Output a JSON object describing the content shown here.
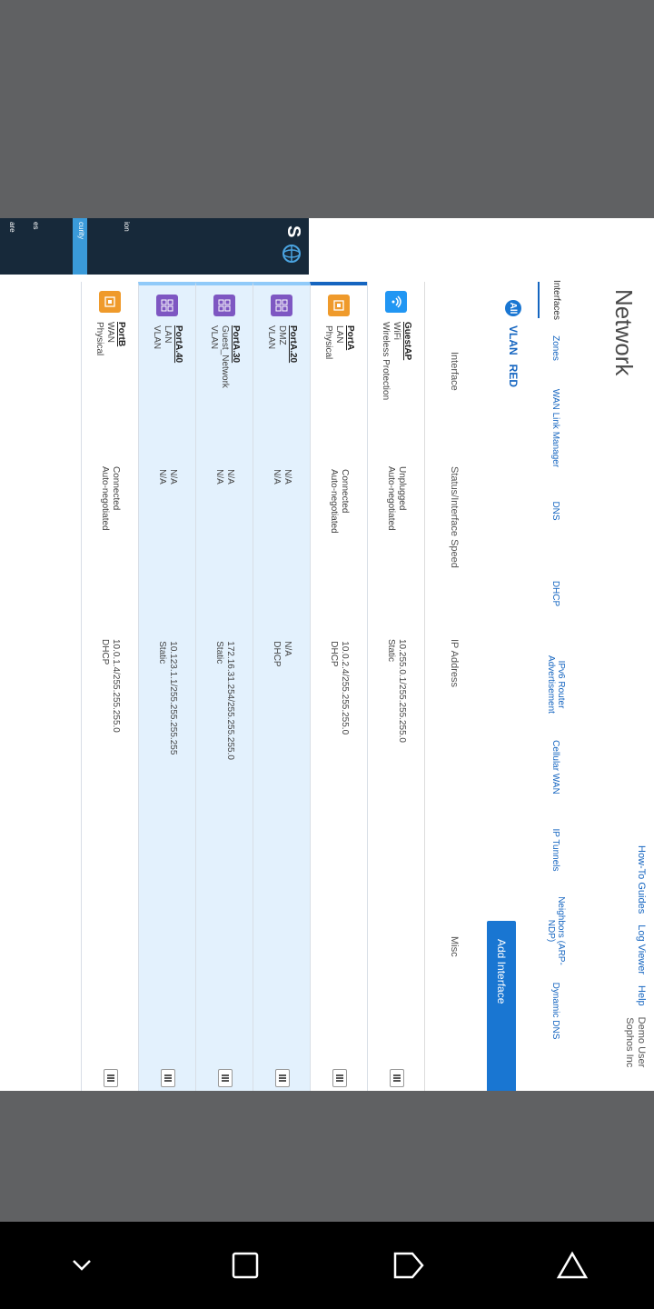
{
  "app": {
    "title": "Network",
    "logo_letter": "S",
    "top_links": [
      "How-To Guides",
      "Log Viewer",
      "Help"
    ],
    "user_name": "Demo User",
    "user_org": "Sophos Inc"
  },
  "tabs": [
    "Interfaces",
    "Zones",
    "WAN Link Manager",
    "DNS",
    "DHCP",
    "IPv6 Router Advertisement",
    "Cellular WAN",
    "IP Tunnels",
    "Neighbors (ARP-NDP)",
    "Dynamic DNS"
  ],
  "filters": {
    "all": "All",
    "vlan": "VLAN",
    "red": "RED"
  },
  "add_button": "Add Interface",
  "columns": {
    "interface": "Interface",
    "status": "Status/Interface Speed",
    "ip": "IP Address",
    "misc": "Misc"
  },
  "rows": [
    {
      "name": "GuestAP",
      "type": "WiFi",
      "sub": "Wireless Protection",
      "icon": "wifi-icon",
      "badge": "wifi",
      "status": "Unplugged",
      "speed": "Auto-negotiated",
      "ip": "10.255.0.1/255.255.255.0",
      "mode": "Static"
    },
    {
      "name": "PortA",
      "type": "LAN",
      "sub": "Physical",
      "icon": "ethernet-icon",
      "badge": "eth",
      "status": "Connected",
      "speed": "Auto-negotiated",
      "ip": "10.0.2.4/255.255.255.0",
      "mode": "DHCP"
    },
    {
      "name": "PortA.20",
      "type": "DMZ",
      "sub": "VLAN",
      "icon": "vlan-icon",
      "badge": "vlan",
      "status": "N/A",
      "speed": "N/A",
      "ip": "N/A",
      "mode": "DHCP"
    },
    {
      "name": "PortA.30",
      "type": "Guest_Network",
      "sub": "VLAN",
      "icon": "vlan-icon",
      "badge": "vlan",
      "status": "N/A",
      "speed": "N/A",
      "ip": "172.16.31.254/255.255.255.0",
      "mode": "Static"
    },
    {
      "name": "PortA.40",
      "type": "LAN",
      "sub": "VLAN",
      "icon": "vlan-icon",
      "badge": "vlan",
      "status": "N/A",
      "speed": "N/A",
      "ip": "10.123.1.1/255.255.255.255",
      "mode": "Static"
    },
    {
      "name": "PortB",
      "type": "WAN",
      "sub": "Physical",
      "icon": "ethernet-icon",
      "badge": "eth",
      "status": "Connected",
      "speed": "Auto-negotiated",
      "ip": "10.0.1.4/255.255.255.0",
      "mode": "DHCP"
    }
  ],
  "sidebar": [
    "ion",
    "curity",
    "es",
    "are"
  ],
  "colors": {
    "accent": "#1976d2",
    "sidebar": "#17293a",
    "highlight_row": "#e3f1fd",
    "sidebar_active": "#3a9ad9"
  }
}
